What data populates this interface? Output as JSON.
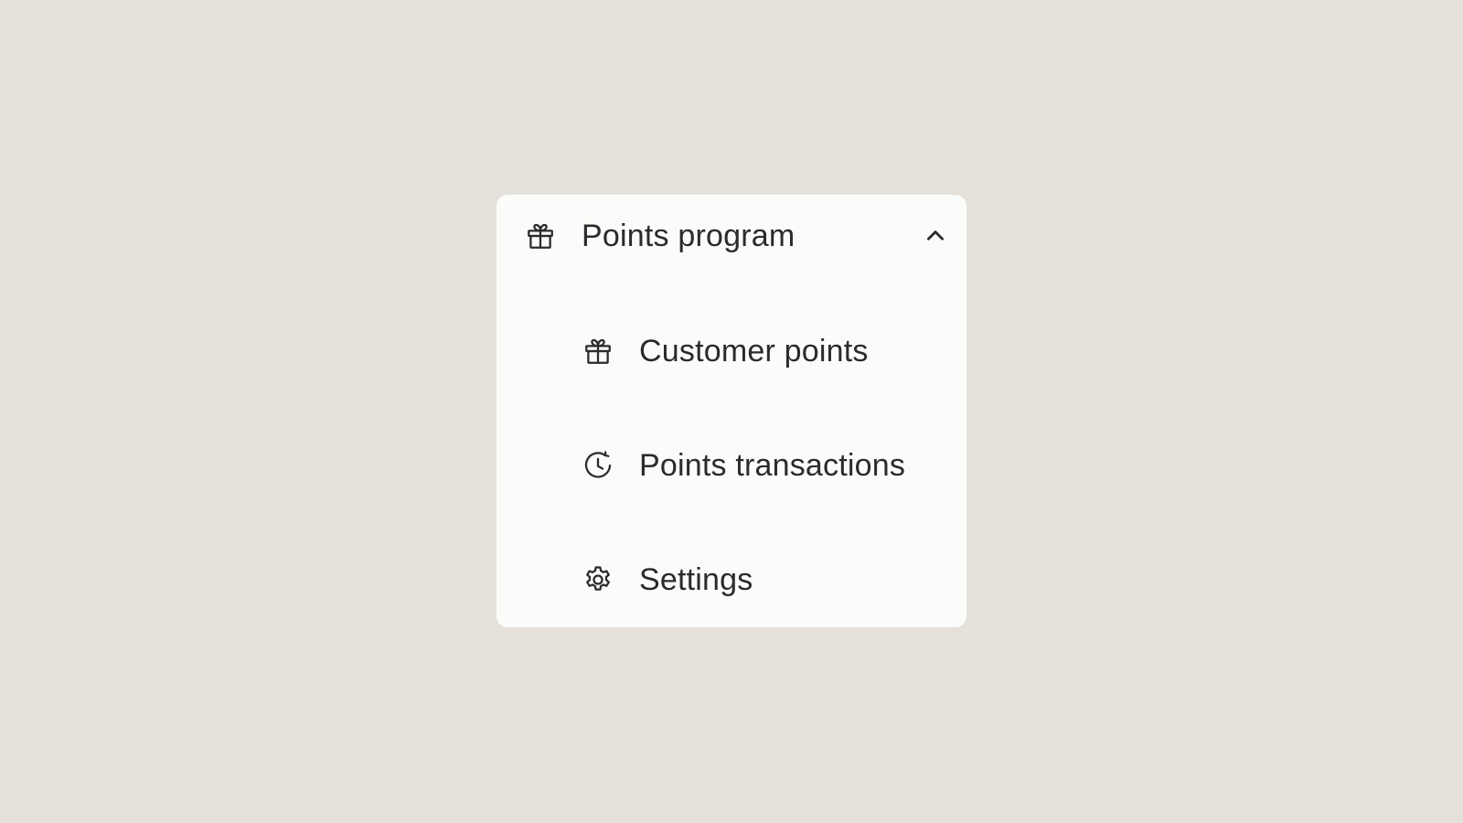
{
  "menu": {
    "header": {
      "label": "Points program",
      "icon": "gift-icon",
      "expanded": true,
      "chevron_icon": "chevron-up-icon"
    },
    "items": [
      {
        "label": "Customer points",
        "icon": "gift-icon"
      },
      {
        "label": "Points transactions",
        "icon": "history-clock-icon"
      },
      {
        "label": "Settings",
        "icon": "gear-icon"
      }
    ]
  },
  "colors": {
    "background": "#e5e0da",
    "panel": "#fbfcf9",
    "text": "#2b2b2b"
  }
}
